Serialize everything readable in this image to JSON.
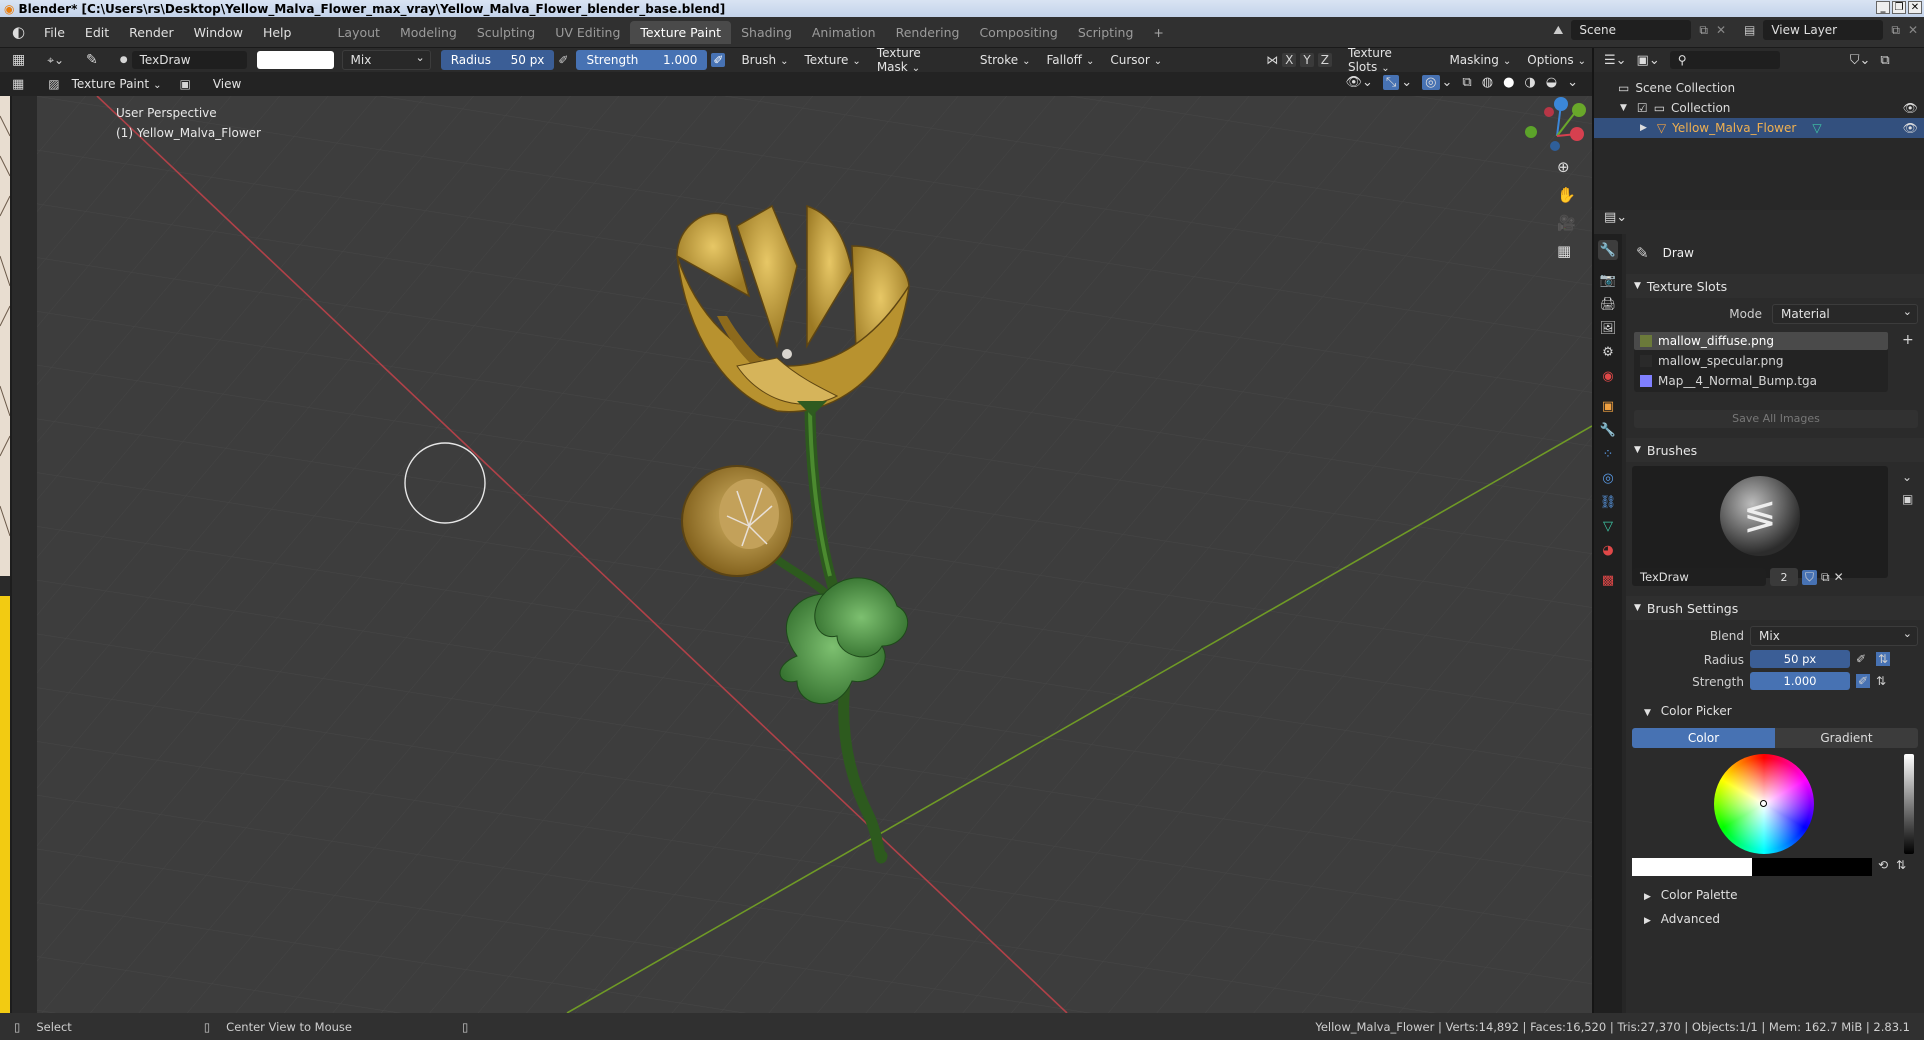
{
  "window": {
    "title": "Blender* [C:\\Users\\rs\\Desktop\\Yellow_Malva_Flower_max_vray\\Yellow_Malva_Flower_blender_base.blend]"
  },
  "menu": [
    "File",
    "Edit",
    "Render",
    "Window",
    "Help"
  ],
  "workspaces": [
    "Layout",
    "Modeling",
    "Sculpting",
    "UV Editing",
    "Texture Paint",
    "Shading",
    "Animation",
    "Rendering",
    "Compositing",
    "Scripting"
  ],
  "active_workspace": "Texture Paint",
  "scene": {
    "scene_name": "Scene",
    "view_layer": "View Layer"
  },
  "tool_header": {
    "brush_name": "TexDraw",
    "blend_mode": "Mix",
    "radius_label": "Radius",
    "radius_value": "50 px",
    "strength_label": "Strength",
    "strength_value": "1.000",
    "menus": [
      "Brush",
      "Texture",
      "Texture Mask",
      "Stroke",
      "Falloff",
      "Cursor"
    ],
    "axes": [
      "X",
      "Y",
      "Z"
    ],
    "right_menus": [
      "Texture Slots",
      "Masking",
      "Options"
    ]
  },
  "viewport_header": {
    "mode": "Texture Paint",
    "view_menu": "View"
  },
  "viewport": {
    "perspective": "User Perspective",
    "object_label": "(1) Yellow_Malva_Flower",
    "gizmo_axes": [
      "Z",
      "Y",
      "X"
    ],
    "accent": "#4772b3"
  },
  "outliner": {
    "items": [
      {
        "label": "Scene Collection"
      },
      {
        "label": "Collection"
      },
      {
        "label": "Yellow_Malva_Flower"
      }
    ]
  },
  "properties": {
    "tool_name": "Draw",
    "texture_slots": {
      "title": "Texture Slots",
      "mode_label": "Mode",
      "mode_value": "Material",
      "slots": [
        "mallow_diffuse.png",
        "mallow_specular.png",
        "Map__4_Normal_Bump.tga"
      ],
      "save_button": "Save All Images"
    },
    "brushes": {
      "title": "Brushes",
      "brush_name": "TexDraw",
      "users": "2"
    },
    "brush_settings": {
      "title": "Brush Settings",
      "blend_label": "Blend",
      "blend_value": "Mix",
      "radius_label": "Radius",
      "radius_value": "50 px",
      "strength_label": "Strength",
      "strength_value": "1.000"
    },
    "color_picker": {
      "title": "Color Picker",
      "tabs": [
        "Color",
        "Gradient"
      ],
      "primary": "#ffffff",
      "secondary": "#000000"
    },
    "collapsed": [
      "Color Palette",
      "Advanced"
    ]
  },
  "statusbar": {
    "left_action": "Select",
    "mid_action": "Center View to Mouse",
    "stats": "Yellow_Malva_Flower | Verts:14,892 | Faces:16,520 | Tris:27,370 | Objects:1/1 | Mem: 162.7 MiB | 2.83.1"
  }
}
